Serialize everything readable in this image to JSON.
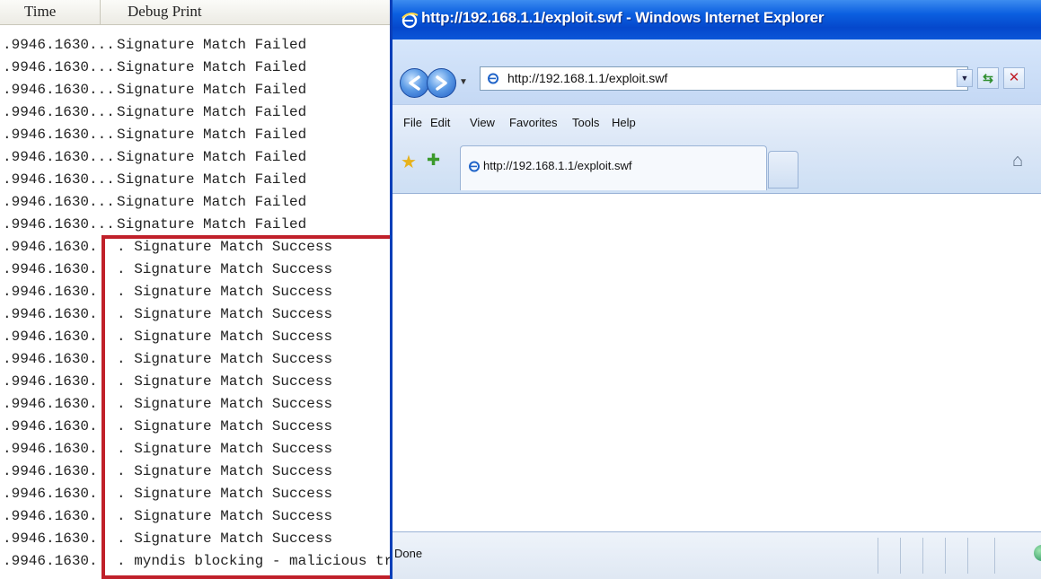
{
  "debug_view": {
    "columns": {
      "time": "Time",
      "debug": "Debug Print"
    },
    "rows": [
      {
        "time": ".9946.1630...",
        "message": "Signature Match Failed"
      },
      {
        "time": ".9946.1630...",
        "message": "Signature Match Failed"
      },
      {
        "time": ".9946.1630...",
        "message": "Signature Match Failed"
      },
      {
        "time": ".9946.1630...",
        "message": "Signature Match Failed"
      },
      {
        "time": ".9946.1630...",
        "message": "Signature Match Failed"
      },
      {
        "time": ".9946.1630...",
        "message": "Signature Match Failed"
      },
      {
        "time": ".9946.1630...",
        "message": "Signature Match Failed"
      },
      {
        "time": ".9946.1630...",
        "message": "Signature Match Failed"
      },
      {
        "time": ".9946.1630...",
        "message": "Signature Match Failed"
      },
      {
        "time": ".9946.1630.",
        "message": ". Signature Match Success"
      },
      {
        "time": ".9946.1630.",
        "message": ". Signature Match Success"
      },
      {
        "time": ".9946.1630.",
        "message": ". Signature Match Success"
      },
      {
        "time": ".9946.1630.",
        "message": ". Signature Match Success"
      },
      {
        "time": ".9946.1630.",
        "message": ". Signature Match Success"
      },
      {
        "time": ".9946.1630.",
        "message": ". Signature Match Success"
      },
      {
        "time": ".9946.1630.",
        "message": ". Signature Match Success"
      },
      {
        "time": ".9946.1630.",
        "message": ". Signature Match Success"
      },
      {
        "time": ".9946.1630.",
        "message": ". Signature Match Success"
      },
      {
        "time": ".9946.1630.",
        "message": ". Signature Match Success"
      },
      {
        "time": ".9946.1630.",
        "message": ". Signature Match Success"
      },
      {
        "time": ".9946.1630.",
        "message": ". Signature Match Success"
      },
      {
        "time": ".9946.1630.",
        "message": ". Signature Match Success"
      },
      {
        "time": ".9946.1630.",
        "message": ". Signature Match Success"
      },
      {
        "time": ".9946.1630.",
        "message": ". myndis blocking - malicious traff"
      }
    ],
    "highlight_color": "#c0202a"
  },
  "ie_window": {
    "title": "http://192.168.1.1/exploit.swf - Windows Internet Explorer",
    "address": "http://192.168.1.1/exploit.swf",
    "menu": [
      "File",
      "Edit",
      "View",
      "Favorites",
      "Tools",
      "Help"
    ],
    "tab_title": "http://192.168.1.1/exploit.swf",
    "status": "Done",
    "title_bar_color": "#0b5fe0",
    "icons": [
      "ie-logo-icon",
      "back-arrow-icon",
      "forward-arrow-icon",
      "refresh-icon",
      "stop-icon",
      "favorites-star-icon",
      "add-favorites-icon",
      "home-icon",
      "globe-icon"
    ]
  }
}
